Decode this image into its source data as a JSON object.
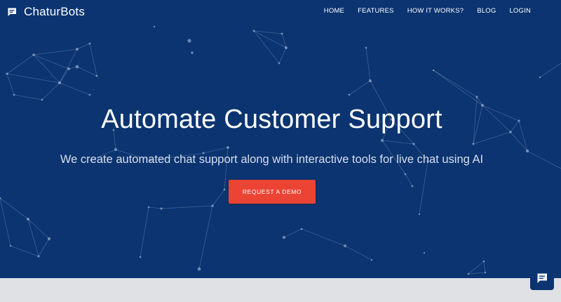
{
  "brand": {
    "name": "ChaturBots",
    "icon": "chat-bubble-icon"
  },
  "nav": {
    "items": [
      {
        "label": "HOME"
      },
      {
        "label": "FEATURES"
      },
      {
        "label": "HOW IT WORKS?"
      },
      {
        "label": "BLOG"
      },
      {
        "label": "LOGIN"
      }
    ]
  },
  "hero": {
    "title": "Automate Customer Support",
    "subtitle": "We create automated chat support along with interactive tools for live chat using AI",
    "cta_label": "REQUEST A DEMO",
    "background": "particle-network"
  },
  "chat_widget": {
    "icon": "chat-bubble-icon"
  },
  "colors": {
    "hero_background": "#0b3470",
    "cta": "#ec4434",
    "bottom_section": "#dfe1e5"
  }
}
